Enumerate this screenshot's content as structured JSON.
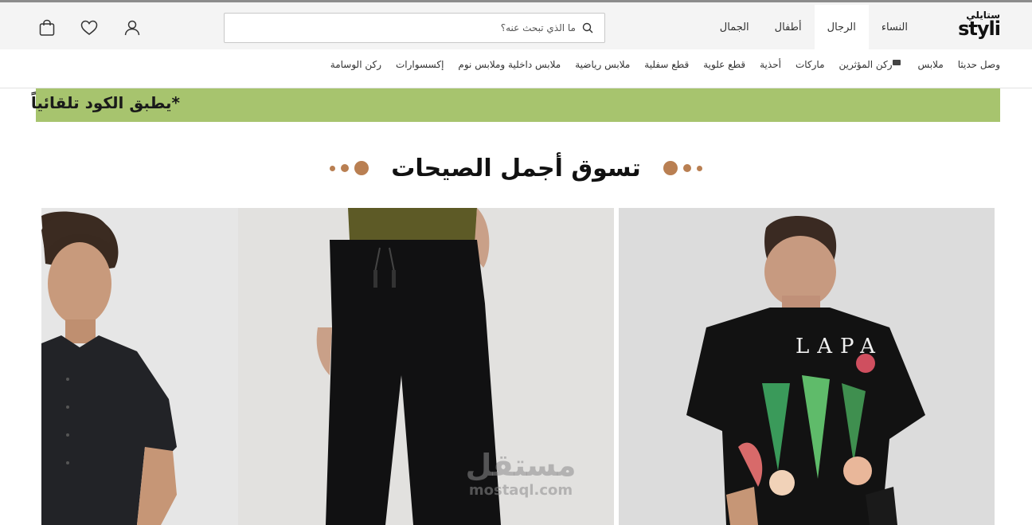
{
  "header": {
    "logo_ar": "ستايلي",
    "logo_en": "styli",
    "gender_tabs": [
      {
        "label": "النساء"
      },
      {
        "label": "الرجال",
        "active": true
      },
      {
        "label": "أطفال"
      },
      {
        "label": "الجمال"
      }
    ],
    "search": {
      "placeholder": "ما الذي تبحث عنه؟",
      "icon": "search-icon"
    },
    "icons": [
      "user-icon",
      "heart-icon",
      "bag-icon"
    ]
  },
  "categories": [
    {
      "label": "وصل حديثا"
    },
    {
      "label": "ملابس"
    },
    {
      "label": "ركن المؤثرين"
    },
    {
      "label": "ماركات"
    },
    {
      "label": "أحذية"
    },
    {
      "label": "قطع علوية"
    },
    {
      "label": "قطع سفلية"
    },
    {
      "label": "ملابس رياضية"
    },
    {
      "label": "ملابس داخلية وملابس نوم"
    },
    {
      "label": "إكسسوارات"
    },
    {
      "label": "ركن الوسامة"
    }
  ],
  "promo": {
    "text": "*يطبق الكود تلقائياً",
    "color": "#a7c46e"
  },
  "section": {
    "title": "تسوق أجمل الصيحات",
    "accent": "#b97f52"
  },
  "watermark": {
    "ar": "مستقل",
    "en": "mostaql.com"
  }
}
